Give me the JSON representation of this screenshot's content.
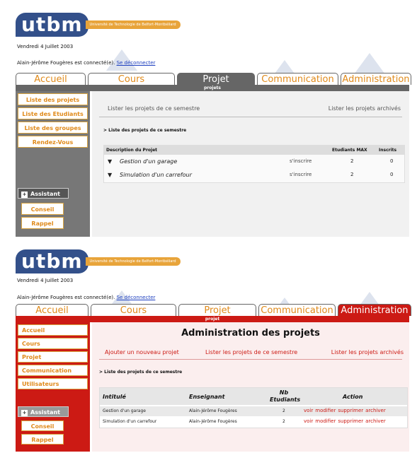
{
  "logo": {
    "text": "utbm",
    "subtitle": "Université de Technologie de Belfort-Montbéliard"
  },
  "date": "Vendredi 4 Juillet 2003",
  "user": {
    "text": "Alain-Jérôme Fougères est connecté(e).",
    "logout": "Se déconnecter"
  },
  "tabs": [
    "Accueil",
    "Cours",
    "Projet",
    "Communication",
    "Administration"
  ],
  "screen1": {
    "strip": "projets",
    "sidebar": [
      "Liste des projets",
      "Liste des Etudiants",
      "Liste des groupes",
      "Rendez-Vous"
    ],
    "assistant": "Assistant",
    "conseil": "Conseil",
    "rappel": "Rappel",
    "link_current": "Lister les projets de ce semestre",
    "link_archived": "Lister les projets archivés",
    "section": "> Liste des projets de ce semestre",
    "table": {
      "headers": [
        "Description du Projet",
        "Etudiants MAX",
        "Inscrits"
      ],
      "rows": [
        {
          "name": "Gestion d'un garage",
          "action": "s'inscrire",
          "max": "2",
          "inscrits": "0"
        },
        {
          "name": "Simulation d'un carrefour",
          "action": "s'inscrire",
          "max": "2",
          "inscrits": "0"
        }
      ]
    }
  },
  "screen2": {
    "strip": "projet",
    "sidebar": [
      "Accueil",
      "Cours",
      "Projet",
      "Communication",
      "Utilisateurs"
    ],
    "assistant": "Assistant",
    "conseil": "Conseil",
    "rappel": "Rappel",
    "title": "Administration des projets",
    "link_add": "Ajouter un nouveau projet",
    "link_current": "Lister les projets de ce semestre",
    "link_archived": "Lister les projets archivés",
    "section": "> Liste des projets de ce semestre",
    "table": {
      "headers": [
        "Intitulé",
        "Enseignant",
        "Nb Etudiants",
        "Action"
      ],
      "rows": [
        {
          "name": "Gestion d'un garage",
          "teacher": "Alain-Jérôme Fougères",
          "nb": "2"
        },
        {
          "name": "Simulation d'un carrefour",
          "teacher": "Alain-Jérôme Fougères",
          "nb": "2"
        }
      ],
      "actions": [
        "voir",
        "modifier",
        "supprimer",
        "archiver"
      ]
    }
  },
  "colors": {
    "orange": "#e08a1a",
    "gray": "#666666",
    "red": "#cc1a14",
    "blue": "#33508a"
  }
}
